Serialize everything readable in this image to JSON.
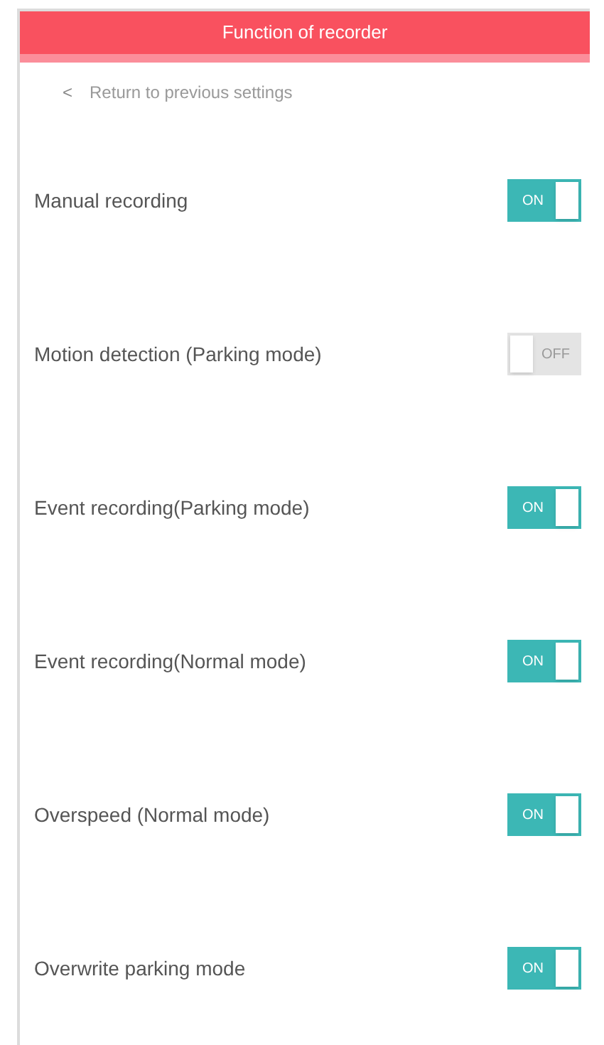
{
  "header": {
    "title": "Function of recorder"
  },
  "subheader": {
    "back": "<",
    "label": "Return to previous settings"
  },
  "settings": [
    {
      "label": "Manual recording",
      "on": true,
      "toggle_text": "ON"
    },
    {
      "label": "Motion detection (Parking mode)",
      "on": false,
      "toggle_text": "OFF"
    },
    {
      "label": "Event recording(Parking mode)",
      "on": true,
      "toggle_text": "ON"
    },
    {
      "label": "Event recording(Normal mode)",
      "on": true,
      "toggle_text": "ON"
    },
    {
      "label": "Overspeed (Normal mode)",
      "on": true,
      "toggle_text": "ON"
    },
    {
      "label": "Overwrite parking mode",
      "on": true,
      "toggle_text": "ON"
    }
  ]
}
